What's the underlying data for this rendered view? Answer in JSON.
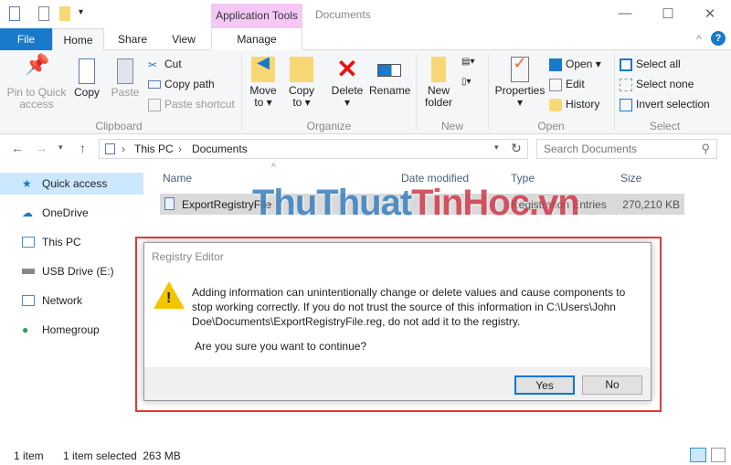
{
  "window": {
    "title": "Documents",
    "context_tab": "Application Tools"
  },
  "tabs": {
    "file": "File",
    "home": "Home",
    "share": "Share",
    "view": "View",
    "manage": "Manage"
  },
  "ribbon": {
    "clipboard": {
      "label": "Clipboard",
      "pin": "Pin to Quick access",
      "copy": "Copy",
      "paste": "Paste",
      "cut": "Cut",
      "copy_path": "Copy path",
      "paste_shortcut": "Paste shortcut"
    },
    "organize": {
      "label": "Organize",
      "move_to": "Move to",
      "copy_to": "Copy to",
      "delete": "Delete",
      "rename": "Rename"
    },
    "new": {
      "label": "New",
      "new_folder": "New folder"
    },
    "open": {
      "label": "Open",
      "properties": "Properties",
      "open": "Open",
      "edit": "Edit",
      "history": "History"
    },
    "select": {
      "label": "Select",
      "select_all": "Select all",
      "select_none": "Select none",
      "invert": "Invert selection"
    }
  },
  "address": {
    "crumbs": [
      "This PC",
      "Documents"
    ],
    "search_placeholder": "Search Documents"
  },
  "sidebar": {
    "items": [
      {
        "label": "Quick access"
      },
      {
        "label": "OneDrive"
      },
      {
        "label": "This PC"
      },
      {
        "label": "USB Drive (E:)"
      },
      {
        "label": "Network"
      },
      {
        "label": "Homegroup"
      }
    ]
  },
  "columns": {
    "name": "Name",
    "date": "Date modified",
    "type": "Type",
    "size": "Size"
  },
  "files": [
    {
      "name": "ExportRegistryFile",
      "type": "Registration Entries",
      "size": "270,210 KB"
    }
  ],
  "dialog": {
    "title": "Registry Editor",
    "message": "Adding information can unintentionally change or delete values and cause components to stop working correctly. If you do not trust the source of this information in C:\\Users\\John Doe\\Documents\\ExportRegistryFile.reg, do not add it to the registry.",
    "question": "Are you sure you want to continue?",
    "yes": "Yes",
    "no": "No"
  },
  "status": {
    "count": "1 item",
    "selected": "1 item selected  263 MB"
  },
  "watermark": {
    "part1": "ThuThuat",
    "part2": "TinHoc.vn"
  },
  "colors": {
    "accent": "#1979ca",
    "context": "#f4c7f4",
    "highlight": "#e53935"
  }
}
